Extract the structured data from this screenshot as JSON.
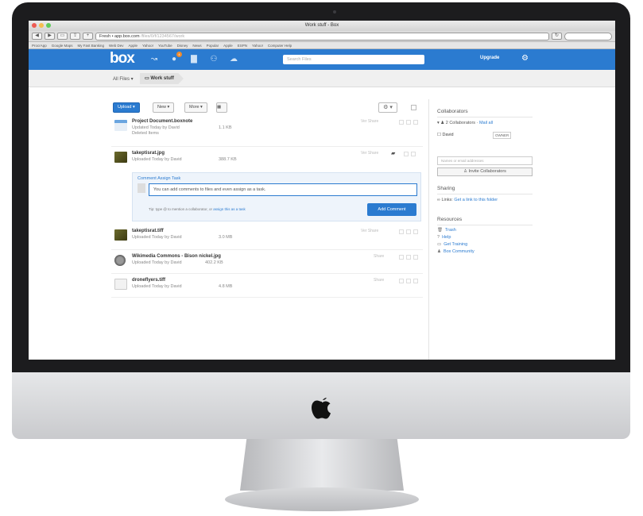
{
  "browser": {
    "window_title": "Work stuff - Box",
    "url_host": "Fresh • app.box.com",
    "url_path": "/files/0/f/1234567/work",
    "bookmarks": [
      "ProcrApp",
      "Google Maps",
      "My Fast Banking",
      "Web Dev",
      "Apple",
      "Yahoo!",
      "YouTube",
      "Disney",
      "News",
      "Popular",
      "Apple",
      "ESPN",
      "Yahoo!",
      "Computer Help"
    ]
  },
  "box": {
    "logo": "box",
    "notification_count": "4",
    "search_placeholder": "Search Files",
    "upgrade_label": "Upgrade"
  },
  "breadcrumb": {
    "all_files": "All Files",
    "current": "Work stuff"
  },
  "actions": {
    "upload": "Upload",
    "new": "New",
    "more": "More"
  },
  "files": [
    {
      "name": "Project Document.boxnote",
      "meta": "Updated Today by David",
      "sub": "Deleted Items",
      "size": "1.1 KB",
      "right": "Ver  Share"
    },
    {
      "name": "takeptisrat.jpg",
      "meta": "Uploaded Today by David",
      "sub": "",
      "size": "388.7 KB",
      "right": "Ver  Share"
    },
    {
      "name": "takeptisrat.tiff",
      "meta": "Uploaded Today by David",
      "sub": "",
      "size": "3.0 MB",
      "right": "Ver  Share"
    },
    {
      "name": "Wikimedia Commons - Bison nickel.jpg",
      "meta": "Uploaded Today by David",
      "sub": "",
      "size": "402.2 KB",
      "right": "Share"
    },
    {
      "name": "droneflyers.tiff",
      "meta": "Uploaded Today by David",
      "sub": "",
      "size": "4.8 MB",
      "right": "Share"
    }
  ],
  "comment": {
    "tabs": "Comment   Assign Task",
    "text": "You can add comments to files and even assign as a task.",
    "hint": "Tip: type @ to mention a collaborator, or",
    "hint_link": "assign this as a task",
    "button": "Add Comment"
  },
  "sidebar": {
    "collab_title": "Collaborators",
    "collab_count": "2 Collaborators",
    "mail_all": "Mail all",
    "collaborator": "David",
    "collaborator_role": "OWNER",
    "invite_placeholder": "Names or email addresses",
    "invite_button": "Invite Collaborators",
    "sharing_title": "Sharing",
    "sharing_text": "Links:",
    "sharing_link": "Get a link to this folder",
    "resources_title": "Resources",
    "resources": [
      "Trash",
      "Help",
      "Get Training",
      "Box Community"
    ]
  },
  "colors": {
    "box_blue": "#2b7bd0",
    "bezel": "#1c1c1e",
    "notification": "#f08a2b"
  }
}
